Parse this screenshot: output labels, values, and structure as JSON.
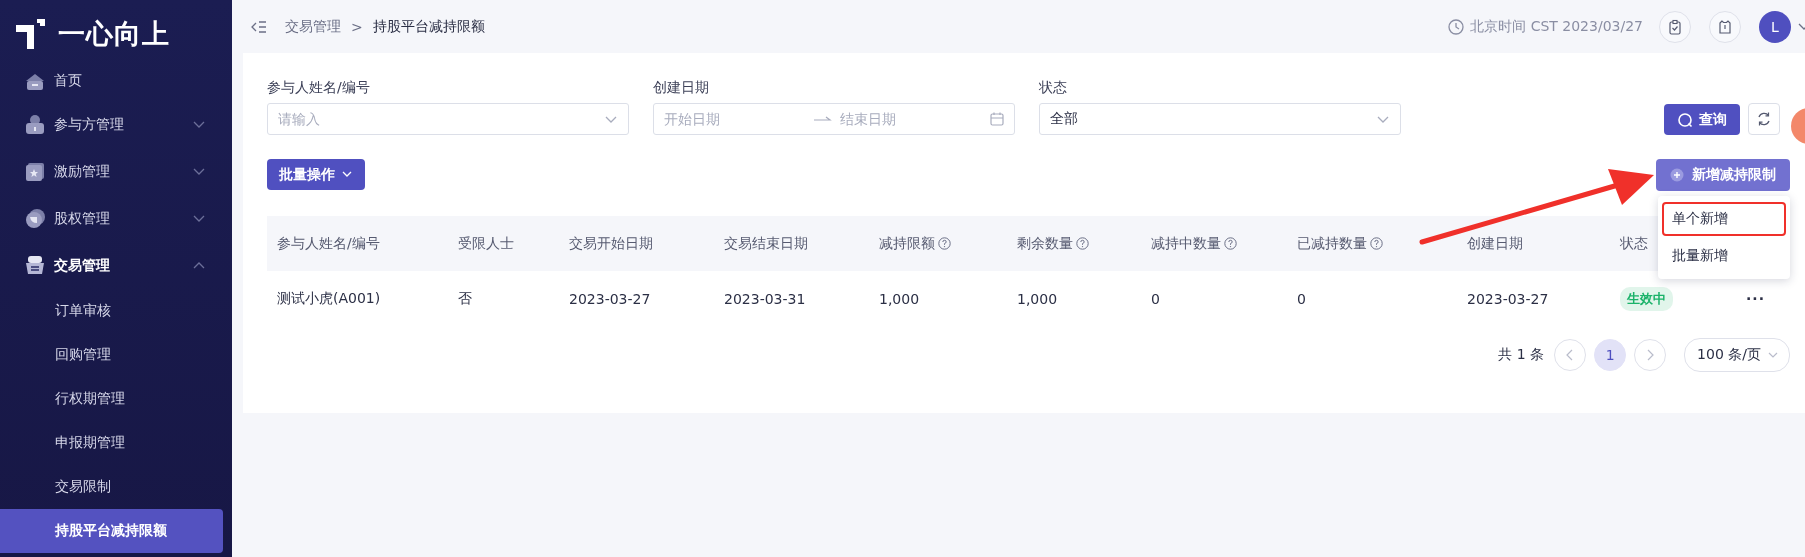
{
  "sidebar": {
    "logo": "一心向上",
    "items": [
      {
        "label": "首页"
      },
      {
        "label": "参与方管理",
        "expanded": false
      },
      {
        "label": "激励管理",
        "expanded": false
      },
      {
        "label": "股权管理",
        "expanded": false
      },
      {
        "label": "交易管理",
        "expanded": true,
        "children": [
          {
            "label": "订单审核",
            "selected": false
          },
          {
            "label": "回购管理",
            "selected": false
          },
          {
            "label": "行权期管理",
            "selected": false
          },
          {
            "label": "申报期管理",
            "selected": false
          },
          {
            "label": "交易限制",
            "selected": false
          },
          {
            "label": "持股平台减持限额",
            "selected": true
          }
        ]
      }
    ]
  },
  "topbar": {
    "breadcrumb": [
      "交易管理",
      "持股平台减持限额"
    ],
    "separator": ">",
    "time": "北京时间 CST 2023/03/27",
    "avatar": "L"
  },
  "filters": [
    {
      "label": "参与人姓名/编号",
      "kind": "select",
      "placeholder": "请输入"
    },
    {
      "label": "创建日期",
      "kind": "daterange",
      "start_placeholder": "开始日期",
      "end_placeholder": "结束日期"
    },
    {
      "label": "状态",
      "kind": "select",
      "value": "全部"
    }
  ],
  "query_button": "查询",
  "batch_button": "批量操作",
  "add_button": "新增减持限制",
  "add_menu": [
    {
      "label": "单个新增",
      "annotated": true
    },
    {
      "label": "批量新增",
      "annotated": false
    }
  ],
  "table": {
    "columns": [
      {
        "label": "参与人姓名/编号",
        "help": false
      },
      {
        "label": "受限人士",
        "help": false
      },
      {
        "label": "交易开始日期",
        "help": false
      },
      {
        "label": "交易结束日期",
        "help": false
      },
      {
        "label": "减持限额",
        "help": true
      },
      {
        "label": "剩余数量",
        "help": true
      },
      {
        "label": "减持中数量",
        "help": true
      },
      {
        "label": "已减持数量",
        "help": true
      },
      {
        "label": "创建日期",
        "help": false
      },
      {
        "label": "状态",
        "help": false
      }
    ],
    "rows": [
      {
        "cells": [
          "测试小虎(A001)",
          "否",
          "2023-03-27",
          "2023-03-31",
          "1,000",
          "1,000",
          "0",
          "0",
          "2023-03-27"
        ],
        "status": {
          "label": "生效中",
          "color": "#1bb36a"
        },
        "more": "···"
      }
    ]
  },
  "pagination": {
    "total": "共 1 条",
    "pages": [
      {
        "label": "1",
        "selected": true
      }
    ],
    "page_size": "100 条/页"
  },
  "annotations": [
    {
      "kind": "arrow"
    }
  ]
}
